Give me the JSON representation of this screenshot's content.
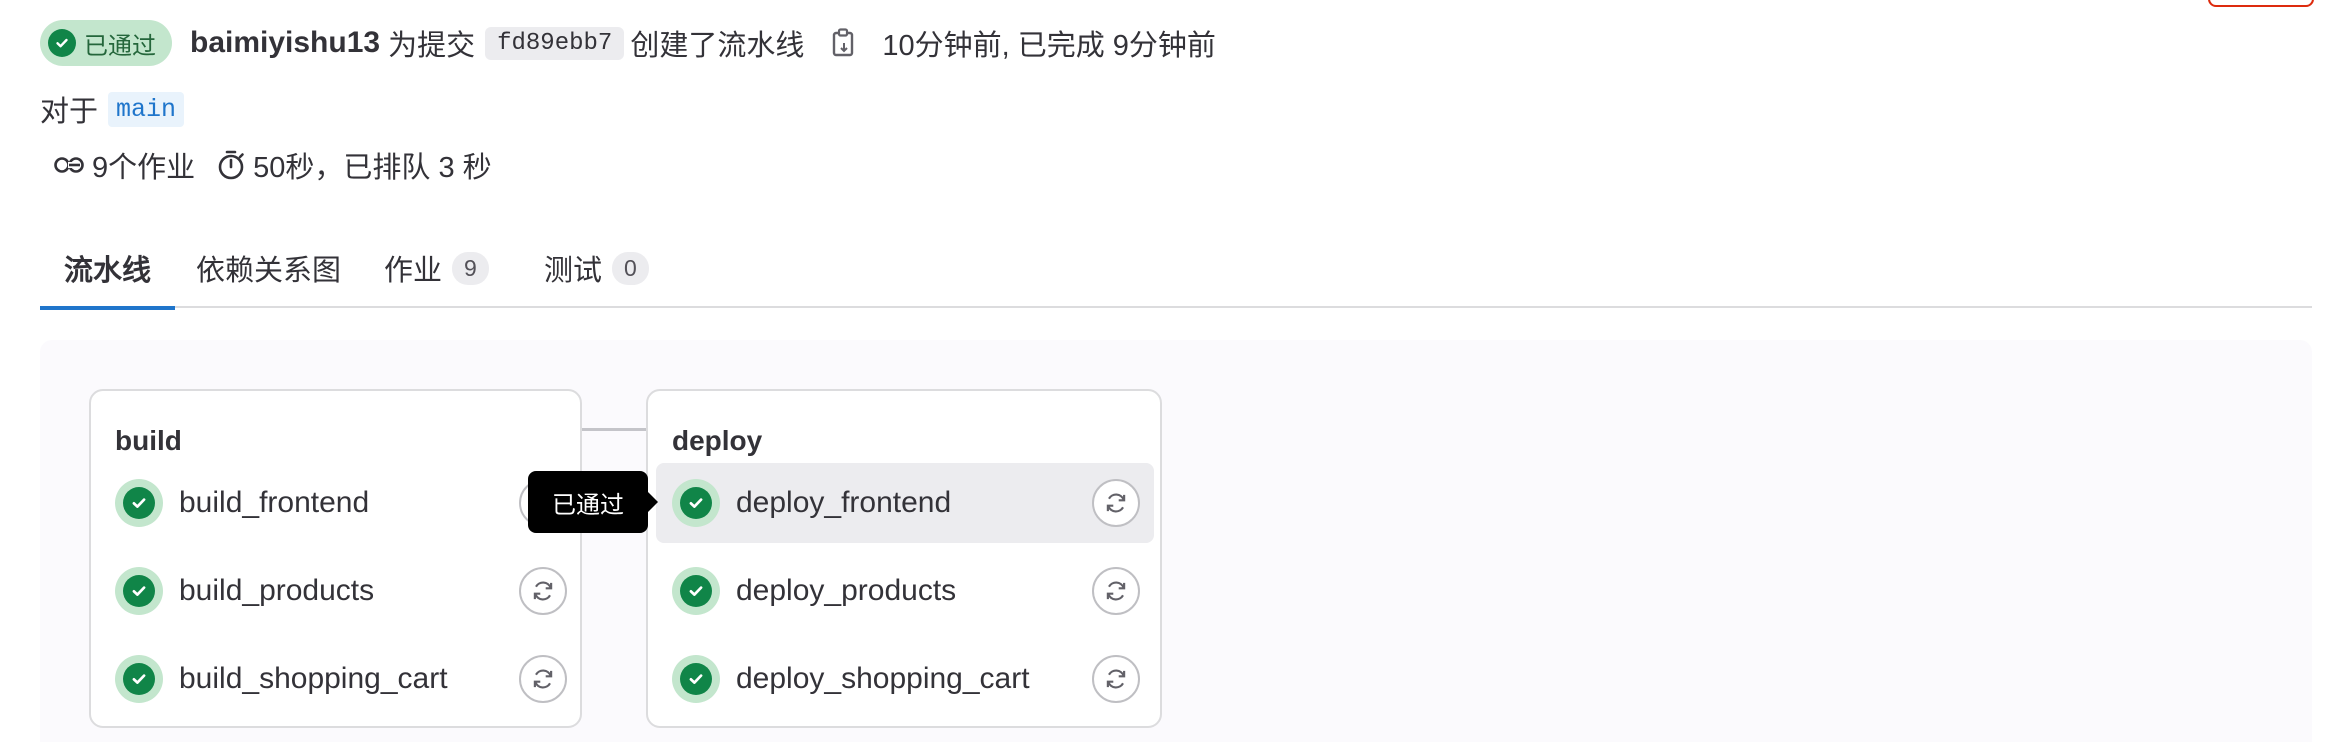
{
  "header": {
    "status_label": "已通过",
    "author": "baimiyishu13",
    "for_commit_text": "为提交",
    "commit_sha": "fd89ebb7",
    "created_text": "创建了流水线",
    "time_text": "10分钟前, 已完成 9分钟前"
  },
  "ref": {
    "label": "对于",
    "branch": "main"
  },
  "meta": {
    "jobs_text": "9个作业",
    "duration_text": "50秒，已排队 3 秒"
  },
  "tabs": [
    {
      "label": "流水线"
    },
    {
      "label": "依赖关系图"
    },
    {
      "label": "作业",
      "count": "9"
    },
    {
      "label": "测试",
      "count": "0"
    }
  ],
  "stages": [
    {
      "title": "build",
      "jobs": [
        {
          "name": "build_frontend"
        },
        {
          "name": "build_products"
        },
        {
          "name": "build_shopping_cart"
        }
      ]
    },
    {
      "title": "deploy",
      "jobs": [
        {
          "name": "deploy_frontend"
        },
        {
          "name": "deploy_products"
        },
        {
          "name": "deploy_shopping_cart"
        }
      ]
    }
  ],
  "tooltip": {
    "text": "已通过"
  },
  "colors": {
    "success": "#108548",
    "success_bg": "#c3e6cd",
    "link": "#1f75cb",
    "danger": "#dd2b0e"
  },
  "icons": {
    "status": "check-circle-icon",
    "copy": "copy-icon",
    "jobs": "pipeline-icon",
    "duration": "timer-icon",
    "retry": "retry-icon"
  }
}
